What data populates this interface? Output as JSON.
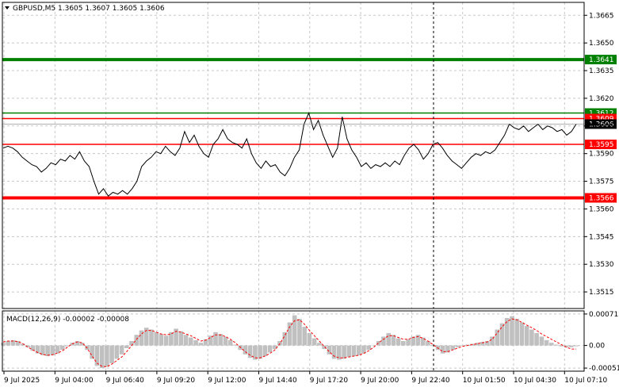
{
  "header": {
    "symbol_line": "GBPUSD,M5  1.3605 1.3607 1.3605 1.3606",
    "macd_line": "MACD(12,26,9) -0.00002 -0.00008"
  },
  "colors": {
    "price_line": "#000000",
    "green_level": "#008000",
    "red_level": "#ff0000",
    "grid": "#c8c8c8",
    "macd_hist": "#c0c0c0",
    "macd_signal": "#ff0000",
    "current_price_bg": "#000000"
  },
  "chart_data": [
    {
      "type": "line",
      "title": "GBPUSD,M5",
      "ylim": [
        1.3506,
        1.3672
      ],
      "y_ticks": [
        "1.3665",
        "1.3650",
        "1.3635",
        "1.3620",
        "1.3605",
        "1.3590",
        "1.3575",
        "1.3560",
        "1.3545",
        "1.3530",
        "1.3515"
      ],
      "y_tick_values": [
        1.3665,
        1.365,
        1.3635,
        1.362,
        1.3605,
        1.359,
        1.3575,
        1.356,
        1.3545,
        1.353,
        1.3515
      ],
      "x_ticks": [
        "9 Jul 2025",
        "9 Jul 04:00",
        "9 Jul 06:40",
        "9 Jul 09:20",
        "9 Jul 12:00",
        "9 Jul 14:40",
        "9 Jul 17:20",
        "9 Jul 20:00",
        "9 Jul 22:40",
        "10 Jul 01:50",
        "10 Jul 04:30",
        "10 Jul 07:10"
      ],
      "levels": [
        {
          "value": 1.3641,
          "label": "1.3641",
          "color": "#008000",
          "style": "thick"
        },
        {
          "value": 1.3612,
          "label": "1.3612",
          "color": "#008000",
          "style": "thin"
        },
        {
          "value": 1.3609,
          "label": "1.3609",
          "color": "#ff0000",
          "style": "thin"
        },
        {
          "value": 1.3595,
          "label": "1.3595",
          "color": "#ff0000",
          "style": "thin"
        },
        {
          "value": 1.3566,
          "label": "1.3566",
          "color": "#ff0000",
          "style": "thick"
        }
      ],
      "current_price": {
        "value": 1.3606,
        "label": "1.3606"
      },
      "series": [
        {
          "values": [
            1.3593,
            1.3594,
            1.3593,
            1.3591,
            1.3588,
            1.3586,
            1.3584,
            1.3583,
            1.358,
            1.3582,
            1.3585,
            1.3584,
            1.3587,
            1.3586,
            1.3589,
            1.3587,
            1.3591,
            1.3586,
            1.3583,
            1.3575,
            1.3568,
            1.3571,
            1.3567,
            1.3569,
            1.3568,
            1.357,
            1.3568,
            1.3571,
            1.3575,
            1.3583,
            1.3586,
            1.3588,
            1.3591,
            1.359,
            1.3594,
            1.3591,
            1.3589,
            1.3593,
            1.3602,
            1.3596,
            1.36,
            1.3594,
            1.359,
            1.3588,
            1.3595,
            1.3598,
            1.3603,
            1.3598,
            1.3596,
            1.3595,
            1.3593,
            1.3598,
            1.359,
            1.3585,
            1.3582,
            1.3586,
            1.3583,
            1.3584,
            1.358,
            1.3578,
            1.3582,
            1.3588,
            1.3592,
            1.3606,
            1.3612,
            1.3603,
            1.3608,
            1.36,
            1.3594,
            1.3588,
            1.3593,
            1.361,
            1.3598,
            1.3592,
            1.3588,
            1.3583,
            1.3585,
            1.3582,
            1.3584,
            1.3583,
            1.3585,
            1.3583,
            1.3586,
            1.3584,
            1.3589,
            1.3593,
            1.3595,
            1.3592,
            1.3587,
            1.359,
            1.3595,
            1.3596,
            1.3593,
            1.3589,
            1.3586,
            1.3584,
            1.3582,
            1.3585,
            1.3588,
            1.359,
            1.3589,
            1.3591,
            1.359,
            1.3592,
            1.3596,
            1.36,
            1.3606,
            1.3604,
            1.3603,
            1.3605,
            1.3602,
            1.3604,
            1.3606,
            1.3603,
            1.3605,
            1.3604,
            1.3602,
            1.3603,
            1.36,
            1.3602,
            1.3606
          ]
        }
      ]
    },
    {
      "type": "bar",
      "title": "MACD(12,26,9)",
      "ylim": [
        -0.00058,
        0.00078
      ],
      "y_ticks": [
        "0.00071",
        "0.00",
        "-0.00051"
      ],
      "y_tick_values": [
        0.00071,
        0.0,
        -0.00051
      ],
      "x_ticks": [
        "9 Jul 2025",
        "9 Jul 04:00",
        "9 Jul 06:40",
        "9 Jul 09:20",
        "9 Jul 12:00",
        "9 Jul 14:40",
        "9 Jul 17:20",
        "9 Jul 20:00",
        "9 Jul 22:40",
        "10 Jul 01:50",
        "10 Jul 04:30",
        "10 Jul 07:10"
      ],
      "series": [
        {
          "name": "MACD",
          "values": [
            6e-05,
            0.0001,
            0.00012,
            0.0001,
            4e-05,
            -4e-05,
            -0.00012,
            -0.00018,
            -0.00022,
            -0.00024,
            -0.00022,
            -0.00018,
            -0.0001,
            -2e-05,
            6e-05,
            0.0001,
            6e-05,
            -0.0001,
            -0.0003,
            -0.00046,
            -0.00051,
            -0.00048,
            -0.0004,
            -0.0003,
            -0.0002,
            -6e-05,
            0.0001,
            0.00024,
            0.00034,
            0.0004,
            0.00036,
            0.0003,
            0.00026,
            0.00022,
            0.0003,
            0.00038,
            0.00032,
            0.00024,
            0.00018,
            0.00012,
            6e-05,
            0.00014,
            0.00022,
            0.0003,
            0.00026,
            0.0002,
            0.00012,
            2e-05,
            -0.0001,
            -0.0002,
            -0.00028,
            -0.00032,
            -0.0003,
            -0.00024,
            -0.00016,
            -8e-05,
            0.0001,
            0.0003,
            0.00052,
            0.00068,
            0.0006,
            0.00042,
            0.00028,
            0.00016,
            6e-05,
            -8e-05,
            -0.0002,
            -0.0003,
            -0.00032,
            -0.0003,
            -0.00026,
            -0.00024,
            -0.00022,
            -0.00018,
            -0.0001,
            0.0,
            0.0001,
            0.0002,
            0.00028,
            0.00024,
            0.00016,
            0.0001,
            0.00014,
            0.0002,
            0.00024,
            0.00018,
            0.0001,
            0.0,
            -0.0001,
            -0.00018,
            -0.00016,
            -0.0001,
            -4e-05,
            0.0,
            2e-05,
            4e-05,
            6e-05,
            8e-05,
            0.0001,
            0.0002,
            0.00036,
            0.0005,
            0.00062,
            0.00066,
            0.0006,
            0.00052,
            0.00044,
            0.00036,
            0.00028,
            0.0002,
            0.00012,
            6e-05,
            2e-05,
            -2e-05,
            -4e-05,
            -4e-05,
            -2e-05
          ]
        },
        {
          "name": "Signal",
          "values": [
            8e-05,
            0.0001,
            0.0001,
            9e-05,
            4e-05,
            -4e-05,
            -0.0001,
            -0.00016,
            -0.0002,
            -0.00022,
            -0.00021,
            -0.00017,
            -0.00012,
            -4e-05,
            4e-05,
            8e-05,
            6e-05,
            -6e-05,
            -0.00024,
            -0.0004,
            -0.00047,
            -0.00048,
            -0.00042,
            -0.00034,
            -0.00026,
            -0.00014,
            0.0,
            0.00014,
            0.00026,
            0.00034,
            0.00034,
            0.0003,
            0.00026,
            0.00024,
            0.00026,
            0.00032,
            0.0003,
            0.00026,
            0.00022,
            0.00016,
            0.0001,
            0.00012,
            0.00018,
            0.00024,
            0.00024,
            0.0002,
            0.00014,
            6e-05,
            -4e-05,
            -0.00014,
            -0.00022,
            -0.00028,
            -0.00028,
            -0.00024,
            -0.00018,
            -0.0001,
            4e-05,
            0.00022,
            0.00042,
            0.00056,
            0.00058,
            0.00048,
            0.00034,
            0.00022,
            0.0001,
            -2e-05,
            -0.00014,
            -0.00024,
            -0.00028,
            -0.00028,
            -0.00026,
            -0.00024,
            -0.00022,
            -0.00018,
            -0.00012,
            -4e-05,
            6e-05,
            0.00014,
            0.00022,
            0.00022,
            0.00018,
            0.00014,
            0.00014,
            0.00018,
            0.0002,
            0.00016,
            0.0001,
            2e-05,
            -6e-05,
            -0.00014,
            -0.00014,
            -0.0001,
            -6e-05,
            -2e-05,
            0.0,
            2e-05,
            4e-05,
            6e-05,
            8e-05,
            0.00014,
            0.00028,
            0.00042,
            0.00054,
            0.0006,
            0.00058,
            0.00052,
            0.00046,
            0.0004,
            0.00034,
            0.00026,
            0.0002,
            0.00014,
            8e-05,
            2e-05,
            -4e-05,
            -8e-05,
            -8e-05
          ]
        }
      ]
    }
  ]
}
